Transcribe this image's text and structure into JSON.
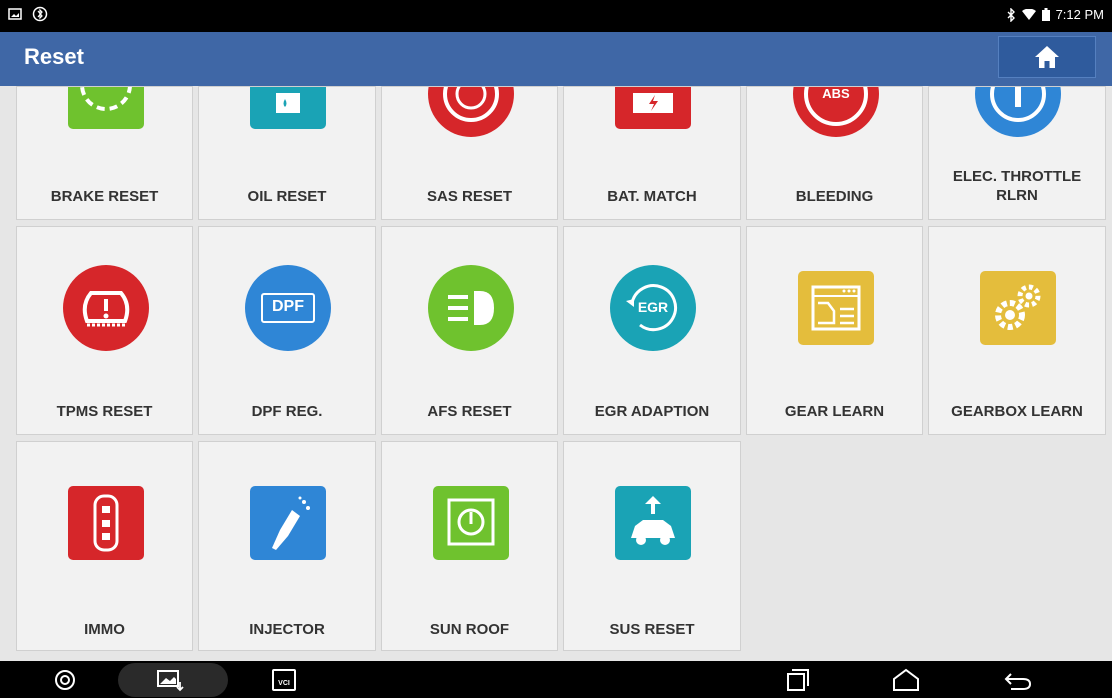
{
  "status_bar": {
    "time": "7:12 PM",
    "icons": [
      "gallery-icon",
      "bluetooth-settings-icon",
      "bluetooth-icon",
      "wifi-icon",
      "battery-icon"
    ]
  },
  "header": {
    "title": "Reset",
    "home_icon": "home-icon"
  },
  "tiles": [
    {
      "label": "BRAKE RESET",
      "icon": "brake-icon",
      "color": "#6fc22e"
    },
    {
      "label": "OIL RESET",
      "icon": "oil-icon",
      "color": "#1aa3b5"
    },
    {
      "label": "SAS RESET",
      "icon": "steering-wheel-icon",
      "color": "#d6262a"
    },
    {
      "label": "BAT. MATCH",
      "icon": "battery-match-icon",
      "color": "#d6262a"
    },
    {
      "label": "BLEEDING",
      "icon": "abs-icon",
      "icon_text": "ABS",
      "color": "#d6262a"
    },
    {
      "label": "ELEC. THROTTLE RLRN",
      "icon": "throttle-icon",
      "color": "#2f86d6"
    },
    {
      "label": "TPMS RESET",
      "icon": "tpms-icon",
      "color": "#d6262a"
    },
    {
      "label": "DPF REG.",
      "icon": "dpf-icon",
      "icon_text": "DPF",
      "color": "#2f86d6"
    },
    {
      "label": "AFS RESET",
      "icon": "headlight-icon",
      "color": "#6fc22e"
    },
    {
      "label": "EGR ADAPTION",
      "icon": "egr-icon",
      "icon_text": "EGR",
      "color": "#1aa3b5"
    },
    {
      "label": "GEAR LEARN",
      "icon": "gear-learn-icon",
      "color": "#e4bd3c"
    },
    {
      "label": "GEARBOX LEARN",
      "icon": "gearbox-icon",
      "color": "#e4bd3c"
    },
    {
      "label": "IMMO",
      "icon": "key-fob-icon",
      "color": "#d6262a"
    },
    {
      "label": "INJECTOR",
      "icon": "injector-icon",
      "color": "#2f86d6"
    },
    {
      "label": "SUN ROOF",
      "icon": "sunroof-icon",
      "color": "#6fc22e"
    },
    {
      "label": "SUS RESET",
      "icon": "suspension-icon",
      "color": "#1aa3b5"
    }
  ],
  "nav_bar": {
    "vci_label": "VCI",
    "icons": [
      "chrome-icon",
      "screenshot-icon",
      "vci-icon",
      "recent-apps-icon",
      "home-nav-icon",
      "back-icon"
    ]
  }
}
